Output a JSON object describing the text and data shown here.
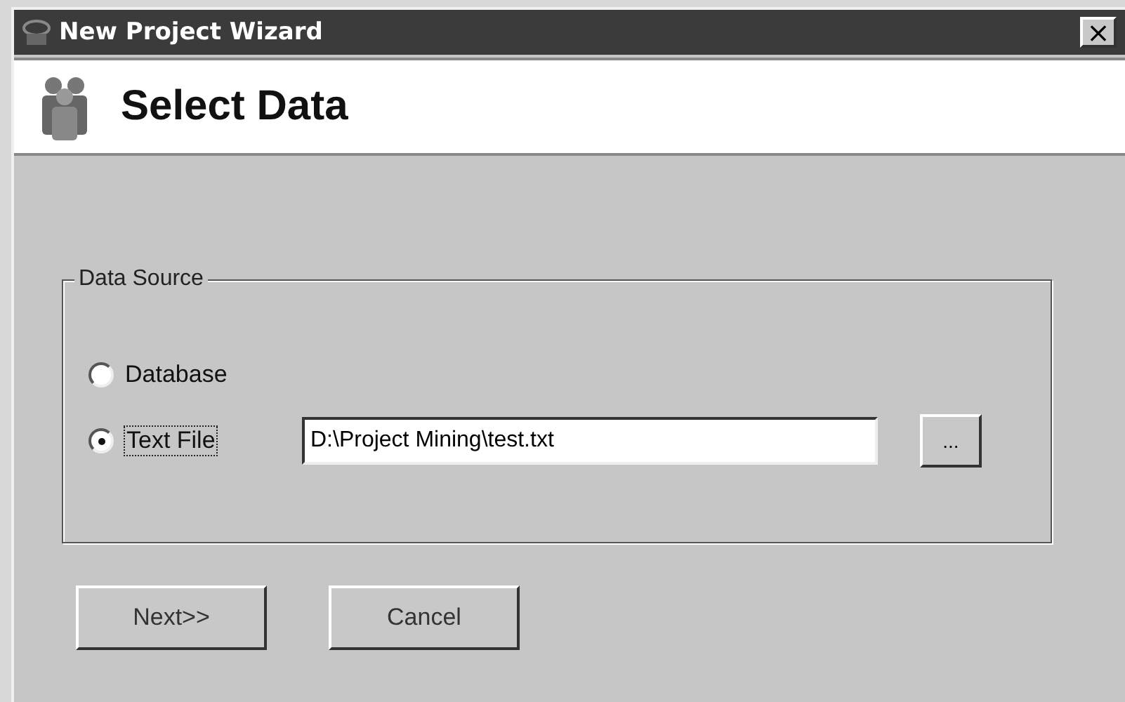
{
  "window": {
    "title": "New Project Wizard",
    "close": "×"
  },
  "header": {
    "title": "Select Data"
  },
  "group": {
    "label": "Data Source",
    "options": [
      {
        "label": "Database",
        "selected": false
      },
      {
        "label": "Text File",
        "selected": true
      }
    ],
    "path_field": {
      "value": "D:\\Project Mining\\test.txt"
    },
    "browse_button": "..."
  },
  "buttons": [
    {
      "label": "Next>>"
    },
    {
      "label": "Cancel"
    }
  ]
}
